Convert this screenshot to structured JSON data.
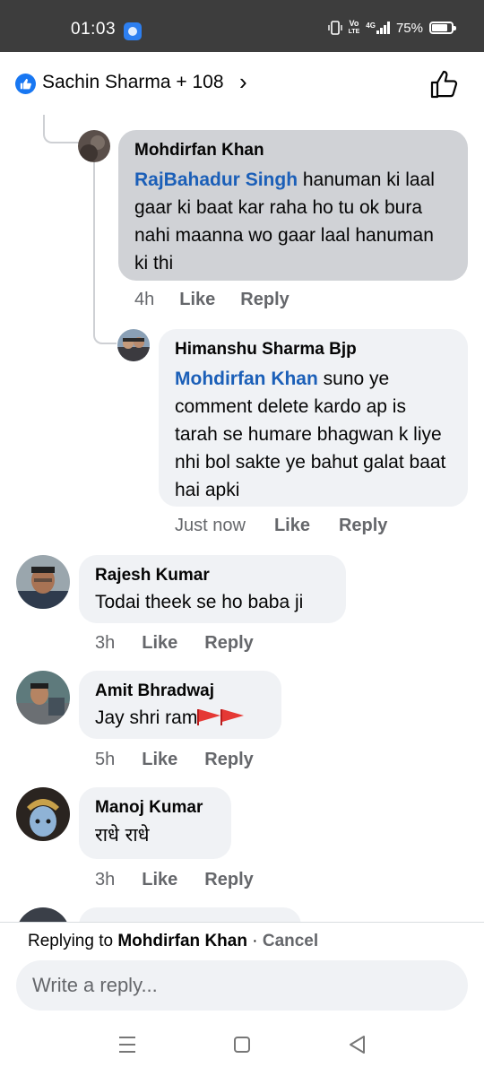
{
  "status_bar": {
    "time": "01:03",
    "network_label_top": "Vo",
    "network_label_bottom": "LTE",
    "network_type": "4G",
    "battery": "75%"
  },
  "reactions": {
    "names": "Sachin Sharma + 108"
  },
  "comments": [
    {
      "author": "Mohdirfan Khan",
      "mention": "RajBahadur Singh",
      "text": " hanuman ki laal gaar ki baat kar raha ho tu ok bura nahi maanna wo gaar laal hanuman ki thi",
      "time": "4h",
      "like": "Like",
      "reply": "Reply"
    },
    {
      "author": "Himanshu Sharma Bjp",
      "mention": "Mohdirfan Khan",
      "text": " suno ye comment delete kardo ap is tarah se humare bhagwan k liye nhi bol sakte ye bahut galat baat hai apki",
      "time": "Just now",
      "like": "Like",
      "reply": "Reply"
    },
    {
      "author": "Rajesh Kumar",
      "text": "Todai theek se ho baba ji",
      "time": "3h",
      "like": "Like",
      "reply": "Reply"
    },
    {
      "author": "Amit Bhradwaj",
      "text": "Jay shri ram",
      "time": "5h",
      "like": "Like",
      "reply": "Reply"
    },
    {
      "author": "Manoj Kumar",
      "text": "राधे राधे",
      "time": "3h",
      "like": "Like",
      "reply": "Reply"
    }
  ],
  "reply_bar": {
    "prefix": "Replying to ",
    "target": "Mohdirfan Khan",
    "separator": " · ",
    "cancel": "Cancel",
    "placeholder": "Write a reply..."
  },
  "colors": {
    "status_bar": "#3d3d3d",
    "brand_blue": "#1877f2",
    "mention_blue": "#1b5fb8",
    "bubble": "#f0f2f5",
    "highlighted_bubble": "#d0d2d6",
    "secondary_text": "#65676b"
  },
  "icons": {
    "reaction_badge": "like-badge-icon",
    "header_action": "thumbs-up-icon",
    "nav": [
      "recents-icon",
      "home-icon",
      "back-icon"
    ]
  }
}
